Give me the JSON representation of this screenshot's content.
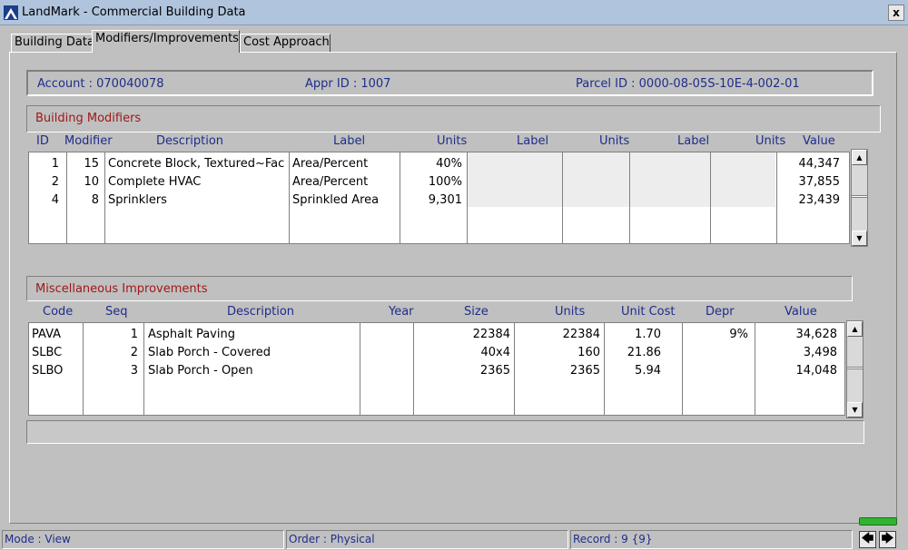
{
  "window": {
    "title": "LandMark - Commercial Building Data",
    "close": "x"
  },
  "tabs": [
    "Building Data",
    "Modifiers/Improvements",
    "Cost Approach"
  ],
  "info": {
    "account": "Account : 070040078",
    "appr": "Appr ID : 1007",
    "parcel": "Parcel ID :  0000-08-05S-10E-4-002-01"
  },
  "modifiers": {
    "title": "Building Modifiers",
    "headers": [
      "ID",
      "Modifier",
      "Description",
      "Label",
      "Units",
      "Label",
      "Units",
      "Label",
      "Units",
      "Value"
    ],
    "rows": [
      {
        "id": "1",
        "modifier": "15",
        "description": "Concrete Block, Textured~Fac",
        "label": "Area/Percent",
        "units": "40%",
        "value": "44,347"
      },
      {
        "id": "2",
        "modifier": "10",
        "description": "Complete HVAC",
        "label": "Area/Percent",
        "units": "100%",
        "value": "37,855"
      },
      {
        "id": "4",
        "modifier": "8",
        "description": "Sprinklers",
        "label": "Sprinkled Area",
        "units": "9,301",
        "value": "23,439"
      }
    ]
  },
  "improvements": {
    "title": "Miscellaneous Improvements",
    "headers": [
      "Code",
      "Seq",
      "Description",
      "Year",
      "Size",
      "Units",
      "Unit Cost",
      "Depr",
      "Value"
    ],
    "rows": [
      {
        "code": "PAVA",
        "seq": "1",
        "description": "Asphalt Paving",
        "year": "",
        "size": "22384",
        "units": "22384",
        "unit_cost": "1.70",
        "depr": "9%",
        "value": "34,628"
      },
      {
        "code": "SLBC",
        "seq": "2",
        "description": "Slab Porch - Covered",
        "year": "",
        "size": "40x4",
        "units": "160",
        "unit_cost": "21.86",
        "depr": "",
        "value": "3,498"
      },
      {
        "code": "SLBO",
        "seq": "3",
        "description": "Slab Porch - Open",
        "year": "",
        "size": "2365",
        "units": "2365",
        "unit_cost": "5.94",
        "depr": "",
        "value": "14,048"
      }
    ]
  },
  "status": {
    "mode": "Mode : View",
    "order": "Order : Physical",
    "record": "Record : 9 {9}"
  },
  "nav": {
    "prev": "🡄",
    "next": "🡆"
  }
}
